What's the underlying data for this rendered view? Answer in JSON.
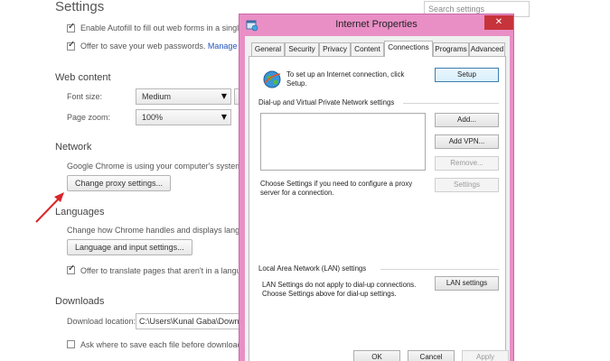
{
  "settings": {
    "title": "Settings",
    "search_placeholder": "Search settings",
    "autofill_label": "Enable Autofill to fill out web forms in a singl",
    "passwords_label": "Offer to save your web passwords.",
    "passwords_link": "Manage p",
    "web_content_heading": "Web content",
    "font_size_label": "Font size:",
    "font_size_value": "Medium",
    "page_zoom_label": "Page zoom:",
    "page_zoom_value": "100%",
    "network_heading": "Network",
    "network_desc": "Google Chrome is using your computer's system",
    "proxy_button": "Change proxy settings...",
    "languages_heading": "Languages",
    "languages_desc": "Change how Chrome handles and displays langua",
    "language_button": "Language and input settings...",
    "translate_label": "Offer to translate pages that aren't in a langu",
    "downloads_heading": "Downloads",
    "download_location_label": "Download location:",
    "download_location_value": "C:\\Users\\Kunal Gaba\\Downlo",
    "ask_save_label": "Ask where to save each file before download"
  },
  "dialog": {
    "title": "Internet Properties",
    "close_glyph": "✕",
    "tabs": [
      "General",
      "Security",
      "Privacy",
      "Content",
      "Connections",
      "Programs",
      "Advanced"
    ],
    "active_tab": "Connections",
    "setup_text": "To set up an Internet connection, click Setup.",
    "setup_button": "Setup",
    "dialup_heading": "Dial-up and Virtual Private Network settings",
    "add_button": "Add...",
    "add_vpn_button": "Add VPN...",
    "remove_button": "Remove...",
    "settings_button": "Settings",
    "proxy_hint": "Choose Settings if you need to configure a proxy server for a connection.",
    "lan_heading": "Local Area Network (LAN) settings",
    "lan_text": "LAN Settings do not apply to dial-up connections. Choose Settings above for dial-up settings.",
    "lan_button": "LAN settings",
    "ok_button": "OK",
    "cancel_button": "Cancel",
    "apply_button": "Apply"
  },
  "colors": {
    "dialog_frame": "#e98fc6",
    "close_button": "#c7333a",
    "arrow": "#d9262c",
    "link": "#2255bb"
  },
  "icons": [
    "check-icon",
    "dropdown-arrow-icon",
    "globe-icon",
    "window-icon",
    "close-icon",
    "red-arrow-icon"
  ]
}
